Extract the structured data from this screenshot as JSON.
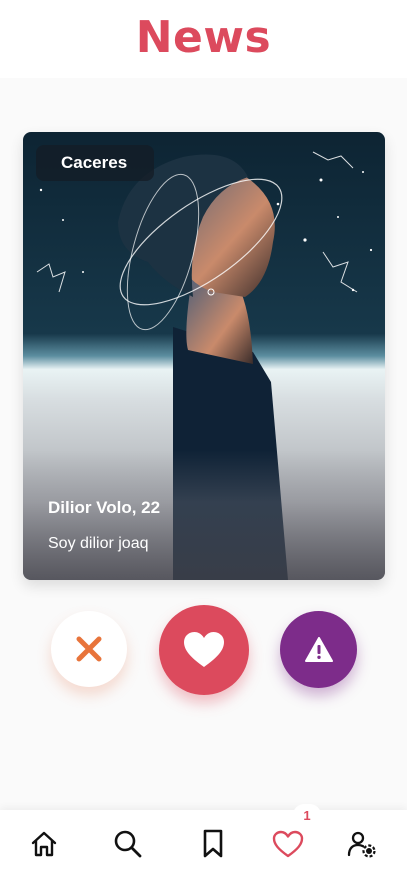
{
  "header": {
    "title": "News"
  },
  "card": {
    "city": "Caceres",
    "name_age": "Dilior Volo, 22",
    "bio": "Soy dilior joaq"
  },
  "actions": {
    "dislike_icon": "close-icon",
    "like_icon": "heart-icon",
    "report_icon": "warning-icon"
  },
  "nav": {
    "items": [
      {
        "icon": "home-icon"
      },
      {
        "icon": "search-icon"
      },
      {
        "icon": "bookmark-icon"
      },
      {
        "icon": "heart-outline-icon",
        "badge": "1"
      },
      {
        "icon": "user-settings-icon"
      }
    ]
  },
  "colors": {
    "brand": "#dc4a5d",
    "dislike": "#e8743b",
    "report": "#7d2c8a"
  }
}
